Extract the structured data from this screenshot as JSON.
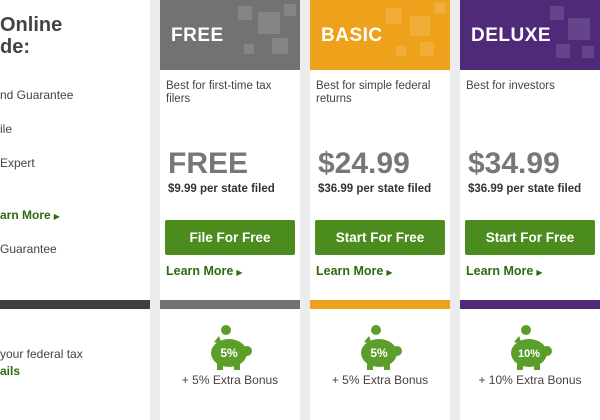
{
  "left": {
    "title": "Online\nde:",
    "items": [
      {
        "label": "nd Guarantee"
      },
      {
        "label": "ile"
      },
      {
        "label": "Expert"
      },
      {
        "label": "Guarantee"
      }
    ],
    "learn_more": "arn More",
    "bottom_text": "your federal tax",
    "bottom_link": "ails"
  },
  "colors": {
    "free": "#727272",
    "basic": "#eea21b",
    "deluxe": "#4f2a79",
    "green_button": "#4c8c1f",
    "green_link": "#2e6b0f"
  },
  "plans": [
    {
      "name": "FREE",
      "desc": "Best for first-time tax filers",
      "price": "FREE",
      "state": "$9.99 per state filed",
      "cta": "File For Free",
      "learn": "Learn More",
      "bonus_badge": "5%",
      "bonus": "+ 5% Extra Bonus"
    },
    {
      "name": "BASIC",
      "desc": "Best for simple federal returns",
      "price": "$24.99",
      "state": "$36.99 per state filed",
      "cta": "Start For Free",
      "learn": "Learn More",
      "bonus_badge": "5%",
      "bonus": "+ 5% Extra Bonus"
    },
    {
      "name": "DELUXE",
      "desc": "Best for investors",
      "price": "$34.99",
      "state": "$36.99 per state filed",
      "cta": "Start For Free",
      "learn": "Learn More",
      "bonus_badge": "10%",
      "bonus": "+ 10% Extra Bonus"
    }
  ]
}
